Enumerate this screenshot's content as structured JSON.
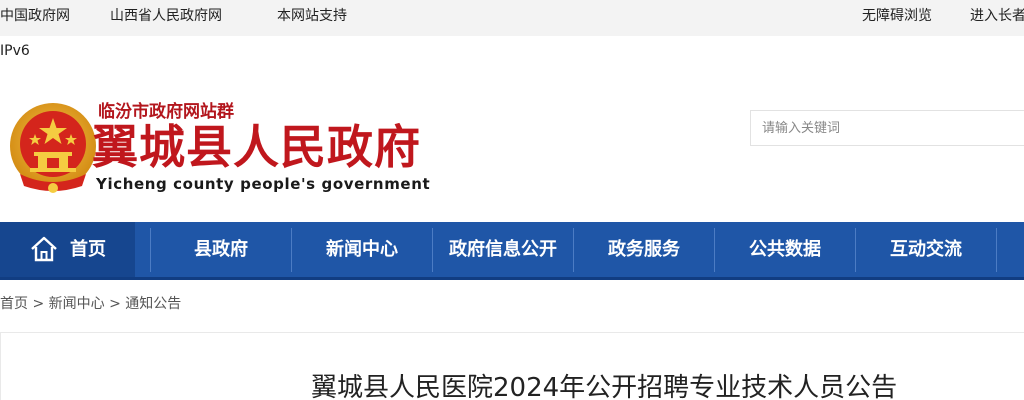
{
  "topbar": {
    "links": [
      "中国政府网",
      "山西省人民政府网",
      "本网站支持"
    ],
    "accessibility": "无障碍浏览",
    "elder_mode": "进入长者"
  },
  "ipv6": "IPv6",
  "header": {
    "site_group": "临汾市政府网站群",
    "site_title": "翼城县人民政府",
    "site_title_en": "Yicheng county people's government",
    "search_placeholder": "请输入关键词"
  },
  "nav": {
    "home": "首页",
    "items": [
      "县政府",
      "新闻中心",
      "政府信息公开",
      "政务服务",
      "公共数据",
      "互动交流"
    ]
  },
  "breadcrumb": [
    "首页",
    "新闻中心",
    "通知公告"
  ],
  "breadcrumb_sep": ">",
  "article": {
    "title": "翼城县人民医院2024年公开招聘专业技术人员公告"
  },
  "colors": {
    "nav_bg": "#1f56a7",
    "nav_active": "#16468f",
    "title_red": "#c0171d"
  }
}
